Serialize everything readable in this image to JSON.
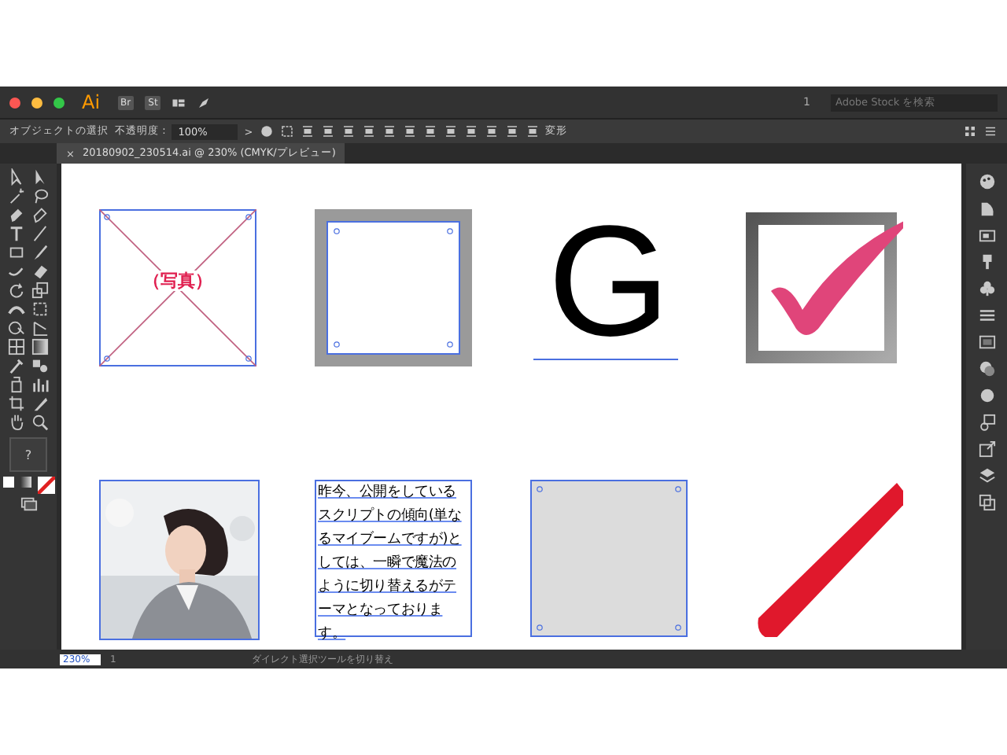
{
  "app": {
    "logo": "Ai",
    "bridge": "Br",
    "stock": "St",
    "page_number": "1",
    "search": {
      "placeholder": "Adobe Stock を検索"
    }
  },
  "control_bar": {
    "selection_label": "オブジェクトの選択",
    "opacity_label": "不透明度 :",
    "opacity_value": "100%",
    "more": ">",
    "transform": "変形"
  },
  "document_tab": {
    "close": "×",
    "title": "20180902_230514.ai @ 230% (CMYK/プレビュー)"
  },
  "toolbar": {
    "fill_label": "?"
  },
  "artboard": {
    "objects": [
      {
        "kind": "placeholder",
        "label": "（写真）"
      },
      {
        "kind": "frame"
      },
      {
        "kind": "letter",
        "text": "G"
      },
      {
        "kind": "checkmark"
      },
      {
        "kind": "picture"
      },
      {
        "kind": "text",
        "text": "昨今、公開をしているスクリプトの傾向(単なるマイブームですが)としては、一瞬で魔法のように切り替えるがテーマとなっております。"
      },
      {
        "kind": "square"
      },
      {
        "kind": "brush"
      }
    ]
  },
  "status_bar": {
    "zoom": "230%",
    "artboard": "1",
    "tool_hint": "ダイレクト選択ツールを切り替え"
  }
}
